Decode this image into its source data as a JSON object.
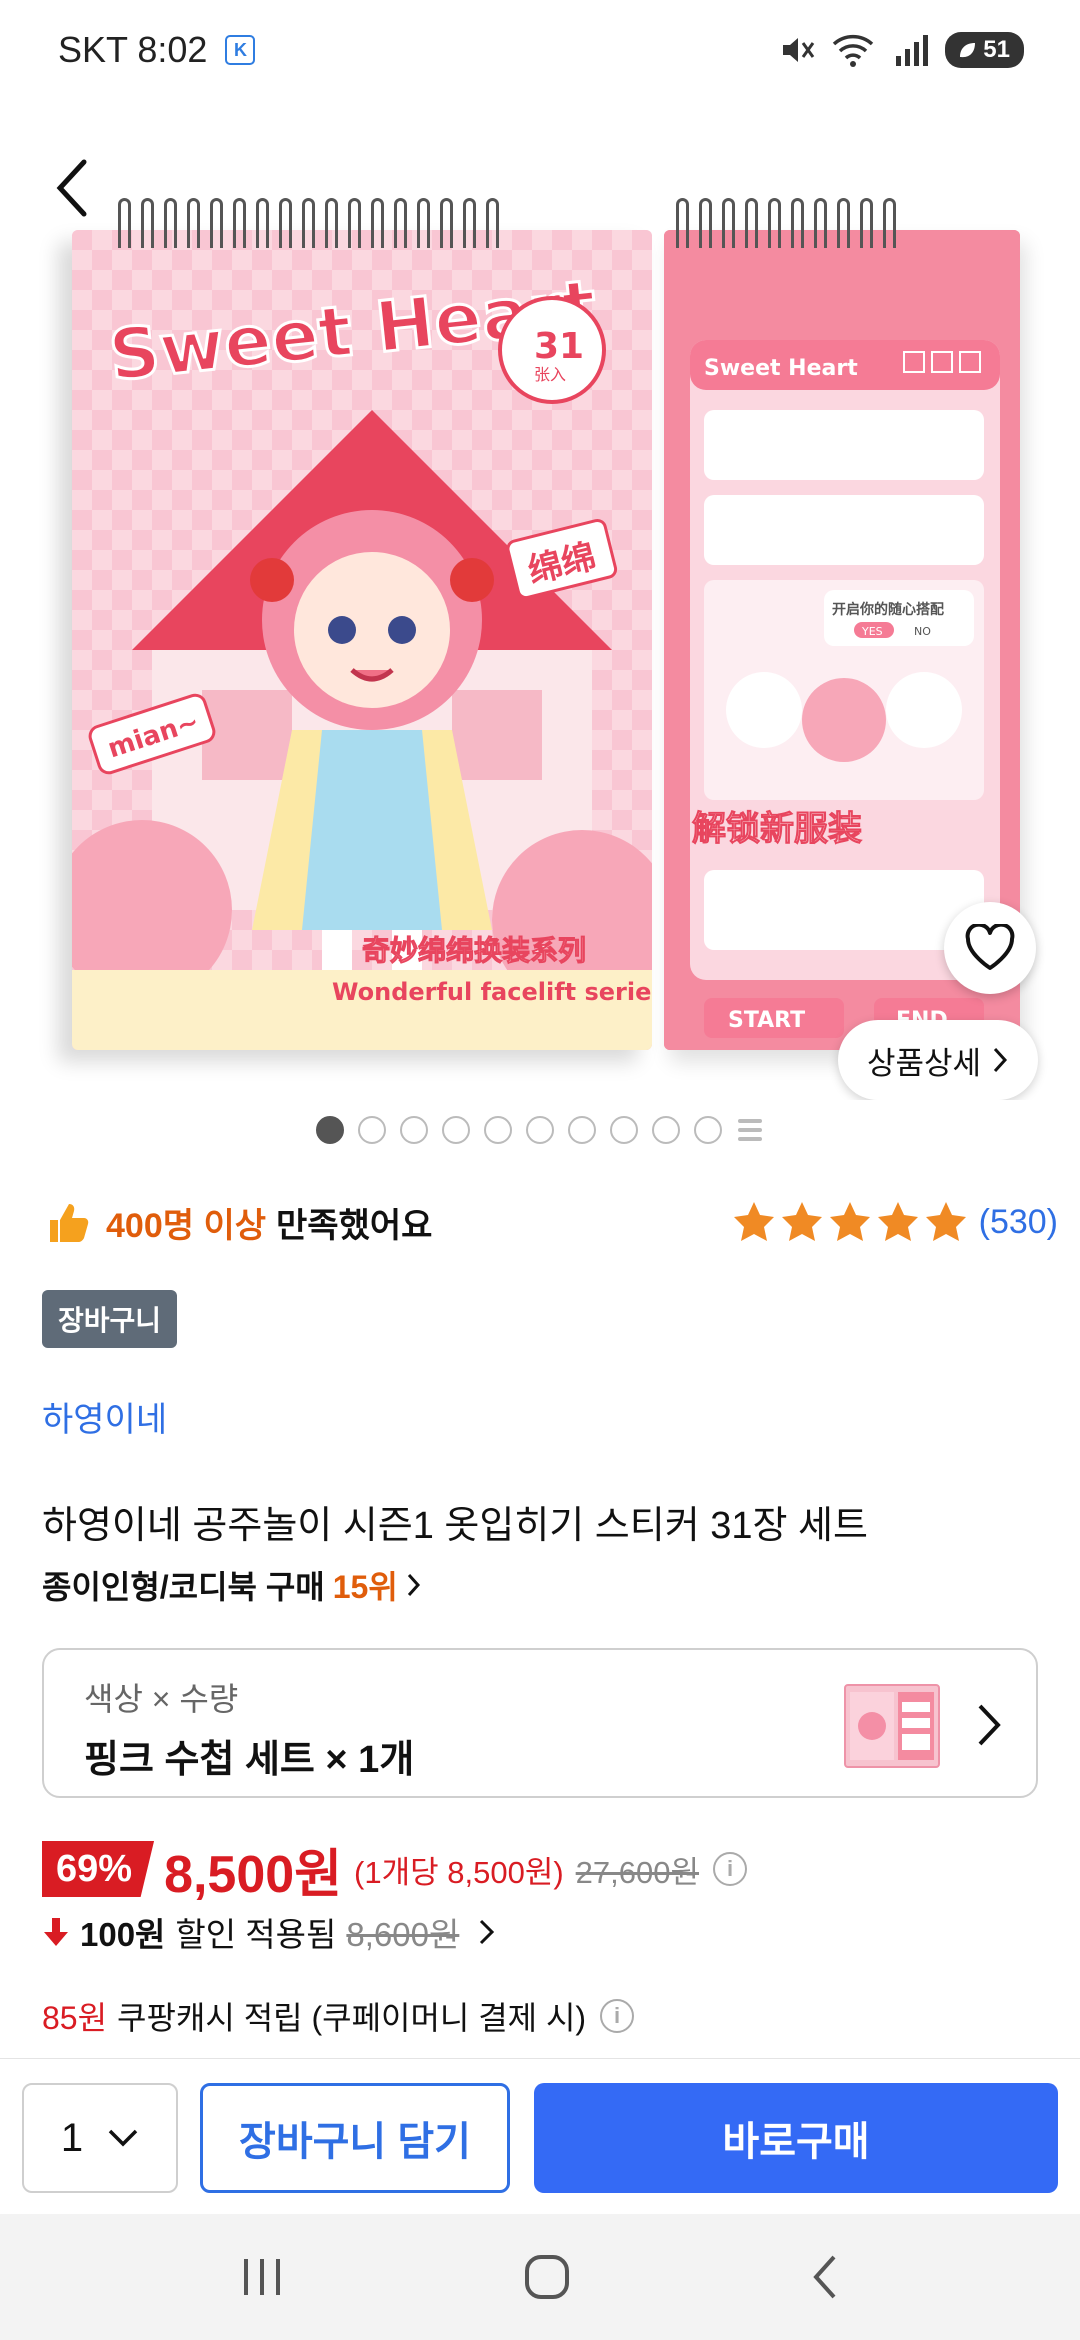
{
  "status_bar": {
    "carrier_time": "SKT 8:02",
    "k_badge": "K",
    "battery": "51"
  },
  "product_image": {
    "detail_button": "상품상세",
    "pad_left_title": "Sweet Heart",
    "pad_left_subtitle": "奇妙绵绵换装系列",
    "pad_left_series": "Wonderful facelift series",
    "pad_left_badge": "31",
    "pad_left_badge_sub": "张入",
    "pad_left_tag": "绵绵",
    "pad_left_sticker": "mian~",
    "pad_right_title": "Sweet Heart",
    "pad_right_unlock": "解锁新服装",
    "pad_right_bubble": "开启你的随心搭配",
    "pad_right_yes": "YES",
    "pad_right_no": "NO",
    "pad_right_start": "START",
    "pad_right_end": "END",
    "carousel_count": 10,
    "carousel_active": 0
  },
  "satisfaction": {
    "highlight": "400명 이상",
    "rest": "만족했어요",
    "stars": 5,
    "review_count": "(530)"
  },
  "cart_badge": "장바구니",
  "brand": "하영이네",
  "title": "하영이네 공주놀이 시즌1 옷입히기 스티커 31장 세트",
  "rank": {
    "label": "종이인형/코디북 구매",
    "position": "15위"
  },
  "option": {
    "label": "색상 × 수량",
    "value": "핑크 수첩 세트 × 1개"
  },
  "price": {
    "discount_pct": "69%",
    "sale_price": "8,500원",
    "unit_price": "(1개당 8,500원)",
    "original_price": "27,600원"
  },
  "discount": {
    "amount": "100원",
    "text": "할인 적용됨",
    "before": "8,600원"
  },
  "cash": {
    "amount": "85원",
    "text": "쿠팡캐시 적립 (쿠페이머니 결제 시)"
  },
  "bottom_bar": {
    "quantity": "1",
    "cart_button": "장바구니 담기",
    "buy_button": "바로구매"
  },
  "colors": {
    "accent_blue": "#346af5",
    "sale_red": "#d91c23",
    "rank_orange": "#e05d0b",
    "star_orange": "#f08a24"
  }
}
